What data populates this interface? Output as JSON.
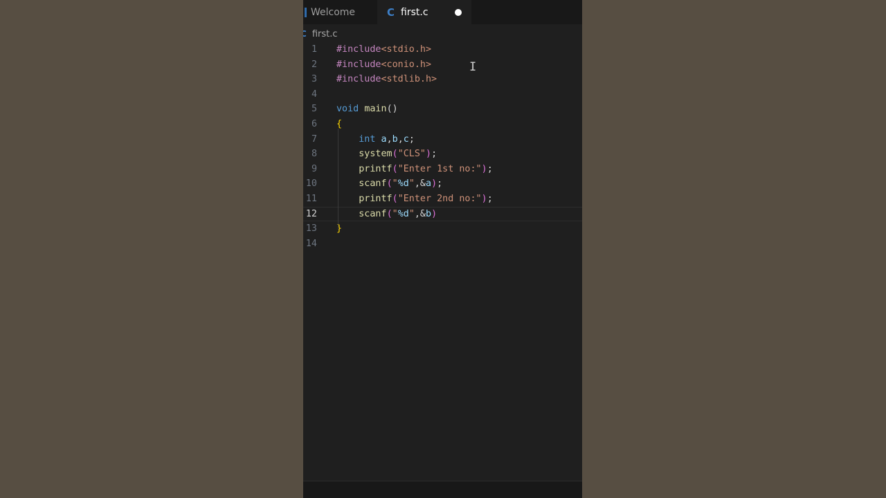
{
  "tabs": {
    "welcome_label": "Welcome",
    "active_label": "first.c",
    "active_icon": "C",
    "active_unsaved": true
  },
  "breadcrumb": {
    "icon": "C",
    "file": "first.c"
  },
  "editor": {
    "current_line": 12,
    "lines": [
      {
        "n": "1",
        "tokens": [
          {
            "t": "#include",
            "c": "kw-pre"
          },
          {
            "t": "<stdio.h>",
            "c": "inc"
          }
        ]
      },
      {
        "n": "2",
        "tokens": [
          {
            "t": "#include",
            "c": "kw-pre"
          },
          {
            "t": "<conio.h>",
            "c": "inc"
          }
        ]
      },
      {
        "n": "3",
        "tokens": [
          {
            "t": "#include",
            "c": "kw-pre"
          },
          {
            "t": "<stdlib.h>",
            "c": "inc"
          }
        ]
      },
      {
        "n": "4",
        "tokens": []
      },
      {
        "n": "5",
        "tokens": [
          {
            "t": "void",
            "c": "kw"
          },
          {
            "t": " ",
            "c": "pun"
          },
          {
            "t": "main",
            "c": "fn"
          },
          {
            "t": "()",
            "c": "pun"
          }
        ]
      },
      {
        "n": "6",
        "tokens": [
          {
            "t": "{",
            "c": "brace"
          }
        ]
      },
      {
        "n": "7",
        "tokens": [
          {
            "t": "    ",
            "c": "pun"
          },
          {
            "t": "int",
            "c": "kw"
          },
          {
            "t": " ",
            "c": "pun"
          },
          {
            "t": "a",
            "c": "var"
          },
          {
            "t": ",",
            "c": "pun"
          },
          {
            "t": "b",
            "c": "var"
          },
          {
            "t": ",",
            "c": "pun"
          },
          {
            "t": "c",
            "c": "var"
          },
          {
            "t": ";",
            "c": "pun"
          }
        ]
      },
      {
        "n": "8",
        "tokens": [
          {
            "t": "    ",
            "c": "pun"
          },
          {
            "t": "system",
            "c": "fn"
          },
          {
            "t": "(",
            "c": "paren"
          },
          {
            "t": "\"CLS\"",
            "c": "str"
          },
          {
            "t": ")",
            "c": "paren"
          },
          {
            "t": ";",
            "c": "pun"
          }
        ]
      },
      {
        "n": "9",
        "tokens": [
          {
            "t": "    ",
            "c": "pun"
          },
          {
            "t": "printf",
            "c": "fn"
          },
          {
            "t": "(",
            "c": "paren"
          },
          {
            "t": "\"Enter 1st no:\"",
            "c": "str"
          },
          {
            "t": ")",
            "c": "paren"
          },
          {
            "t": ";",
            "c": "pun"
          }
        ]
      },
      {
        "n": "10",
        "tokens": [
          {
            "t": "    ",
            "c": "pun"
          },
          {
            "t": "scanf",
            "c": "fn"
          },
          {
            "t": "(",
            "c": "paren"
          },
          {
            "t": "\"",
            "c": "str"
          },
          {
            "t": "%d",
            "c": "esc"
          },
          {
            "t": "\"",
            "c": "str"
          },
          {
            "t": ",&",
            "c": "pun"
          },
          {
            "t": "a",
            "c": "var"
          },
          {
            "t": ")",
            "c": "paren"
          },
          {
            "t": ";",
            "c": "pun"
          }
        ]
      },
      {
        "n": "11",
        "tokens": [
          {
            "t": "    ",
            "c": "pun"
          },
          {
            "t": "printf",
            "c": "fn"
          },
          {
            "t": "(",
            "c": "paren"
          },
          {
            "t": "\"Enter 2nd no:\"",
            "c": "str"
          },
          {
            "t": ")",
            "c": "paren"
          },
          {
            "t": ";",
            "c": "pun"
          }
        ]
      },
      {
        "n": "12",
        "tokens": [
          {
            "t": "    ",
            "c": "pun"
          },
          {
            "t": "scanf",
            "c": "fn"
          },
          {
            "t": "(",
            "c": "paren"
          },
          {
            "t": "\"",
            "c": "str"
          },
          {
            "t": "%d",
            "c": "esc"
          },
          {
            "t": "\"",
            "c": "str"
          },
          {
            "t": ",&",
            "c": "pun"
          },
          {
            "t": "b",
            "c": "var"
          },
          {
            "t": ")",
            "c": "paren"
          }
        ]
      },
      {
        "n": "13",
        "tokens": [
          {
            "t": "}",
            "c": "brace"
          }
        ]
      },
      {
        "n": "14",
        "tokens": []
      }
    ]
  },
  "icons": {
    "c_file": "c-language-icon",
    "unsaved": "unsaved-dot-icon",
    "mouse_cursor": "text-cursor-icon"
  },
  "colors": {
    "editor_bg": "#1f1f1f",
    "tabbar_bg": "#181818",
    "side_bg": "#574e42"
  }
}
